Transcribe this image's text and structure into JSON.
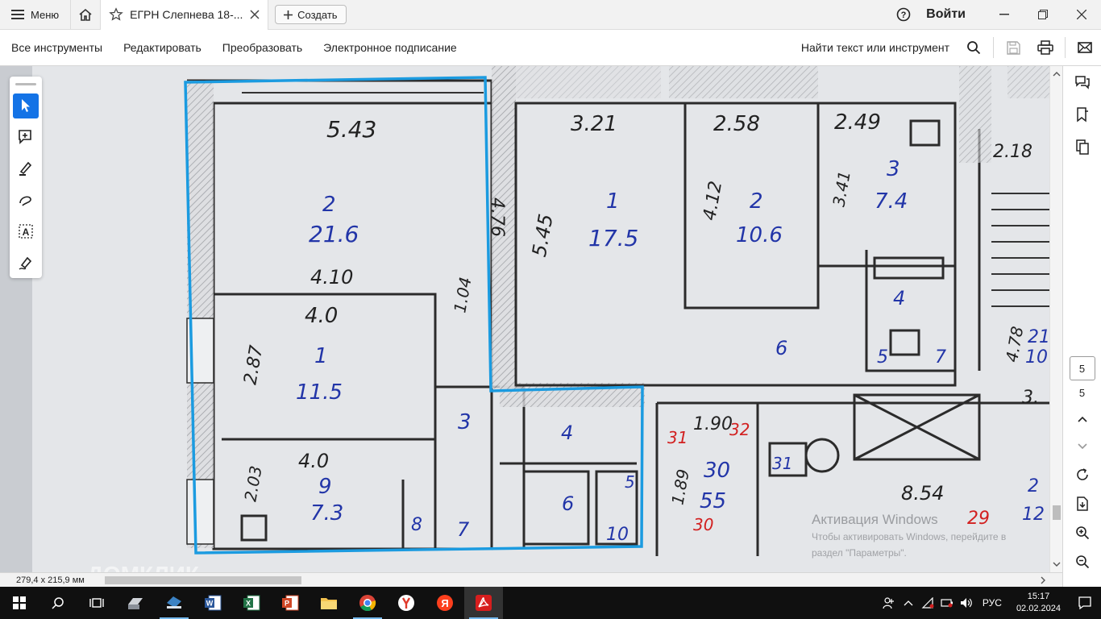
{
  "titlebar": {
    "menu_label": "Меню",
    "tab_title": "ЕГРН Слепнева 18-...",
    "create_label": "Создать",
    "signin_label": "Войти"
  },
  "toolbar": {
    "items": [
      "Все инструменты",
      "Редактировать",
      "Преобразовать",
      "Электронное подписание"
    ],
    "find_label": "Найти текст или инструмент"
  },
  "plan": {
    "left_unit": {
      "dims": [
        "5.43",
        "4.76",
        "4.10",
        "1.04",
        "4.0",
        "2.87",
        "4.0",
        "2.03"
      ],
      "rooms": [
        {
          "num": "2",
          "area": "21.6"
        },
        {
          "num": "1",
          "area": "11.5"
        },
        {
          "num": "9",
          "area": "7.3"
        }
      ],
      "labels": [
        "3",
        "4",
        "6",
        "7",
        "8",
        "10",
        "5"
      ]
    },
    "right_unit": {
      "dims": [
        "3.21",
        "2.58",
        "2.49",
        "5.45",
        "4.12",
        "3.41",
        "2.18",
        "1.90",
        "1.89",
        "8.54",
        "4.78",
        "3."
      ],
      "rooms": [
        {
          "num": "1",
          "area": "17.5"
        },
        {
          "num": "2",
          "area": "10.6"
        },
        {
          "num": "3",
          "area": "7.4"
        },
        {
          "num": "30",
          "area": "55"
        }
      ],
      "labels": [
        "4",
        "5",
        "6",
        "7",
        "31",
        "21",
        "10",
        "2",
        "12"
      ],
      "red_labels": [
        "31",
        "32",
        "30",
        "29"
      ]
    },
    "watermark": "ДОМКЛИК",
    "activation_title": "Активация Windows",
    "activation_line1": "Чтобы активировать Windows, перейдите в",
    "activation_line2": "раздел \"Параметры\"."
  },
  "pagination": {
    "current_page": "5",
    "total_pages": "5"
  },
  "status": {
    "page_dimensions": "279,4 x 215,9 мм"
  },
  "taskbar": {
    "language": "РУС",
    "time": "15:17",
    "date": "02.02.2024"
  }
}
